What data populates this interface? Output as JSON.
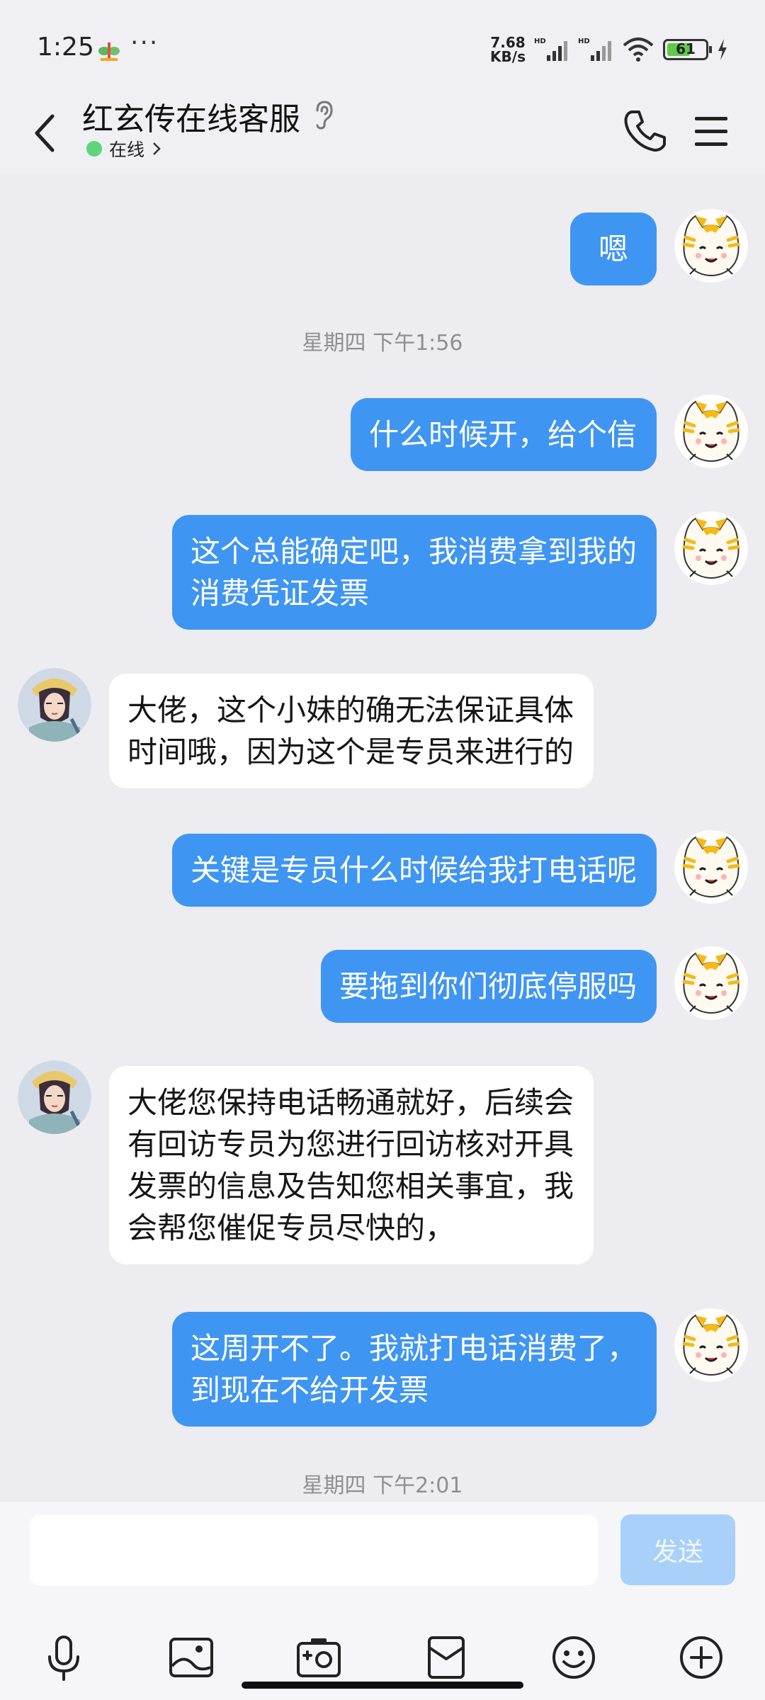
{
  "status_bar": {
    "time": "1:25",
    "more": "···",
    "net_speed": "7.68",
    "net_unit": "KB/s",
    "battery": "61"
  },
  "header": {
    "title": "红玄传在线客服",
    "status": "在线",
    "status_color": "#5fd47a"
  },
  "messages": [
    {
      "side": "right",
      "text": "嗯"
    },
    {
      "type": "time",
      "text": "星期四 下午1:56"
    },
    {
      "side": "right",
      "text": "什么时候开，给个信"
    },
    {
      "side": "right",
      "text": "这个总能确定吧，我消费拿到我的\n消费凭证发票"
    },
    {
      "side": "left",
      "text": "大佬，这个小妹的确无法保证具体\n时间哦，因为这个是专员来进行的"
    },
    {
      "side": "right",
      "text": "关键是专员什么时候给我打电话呢"
    },
    {
      "side": "right",
      "text": "要拖到你们彻底停服吗"
    },
    {
      "side": "left",
      "text": "大佬您保持电话畅通就好，后续会\n有回访专员为您进行回访核对开具\n发票的信息及告知您相关事宜，我\n会帮您催促专员尽快的，"
    },
    {
      "side": "right",
      "text": "这周开不了。我就打电话消费了，\n到现在不给开发票"
    },
    {
      "type": "time",
      "text": "星期四 下午2:01"
    }
  ],
  "input": {
    "placeholder": "",
    "send_label": "发送"
  },
  "toolbar": [
    "microphone-icon",
    "image-icon",
    "camera-icon",
    "red-packet-icon",
    "emoji-icon",
    "plus-icon"
  ],
  "colors": {
    "my_bubble": "#3f95f2",
    "their_bubble": "#ffffff",
    "send_disabled": "#a9d0f9"
  }
}
